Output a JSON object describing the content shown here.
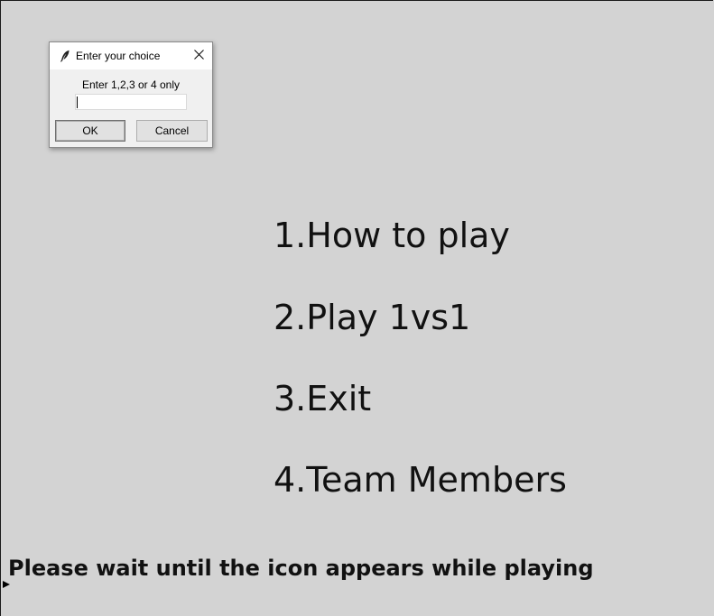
{
  "dialog": {
    "title": "Enter your choice",
    "prompt": "Enter 1,2,3 or 4 only",
    "input_value": "",
    "ok_label": "OK",
    "cancel_label": "Cancel",
    "title_icon": "feather-icon",
    "close_icon": "close-icon"
  },
  "menu": {
    "items": [
      {
        "label": "1.How to play"
      },
      {
        "label": "2.Play 1vs1"
      },
      {
        "label": "3.Exit"
      },
      {
        "label": "4.Team Members"
      }
    ]
  },
  "footer": {
    "wait_message": "Please wait until the icon appears while playing"
  },
  "colors": {
    "canvas_bg": "#d3d3d3",
    "dialog_bg": "#f0f0f0",
    "text": "#111111"
  }
}
